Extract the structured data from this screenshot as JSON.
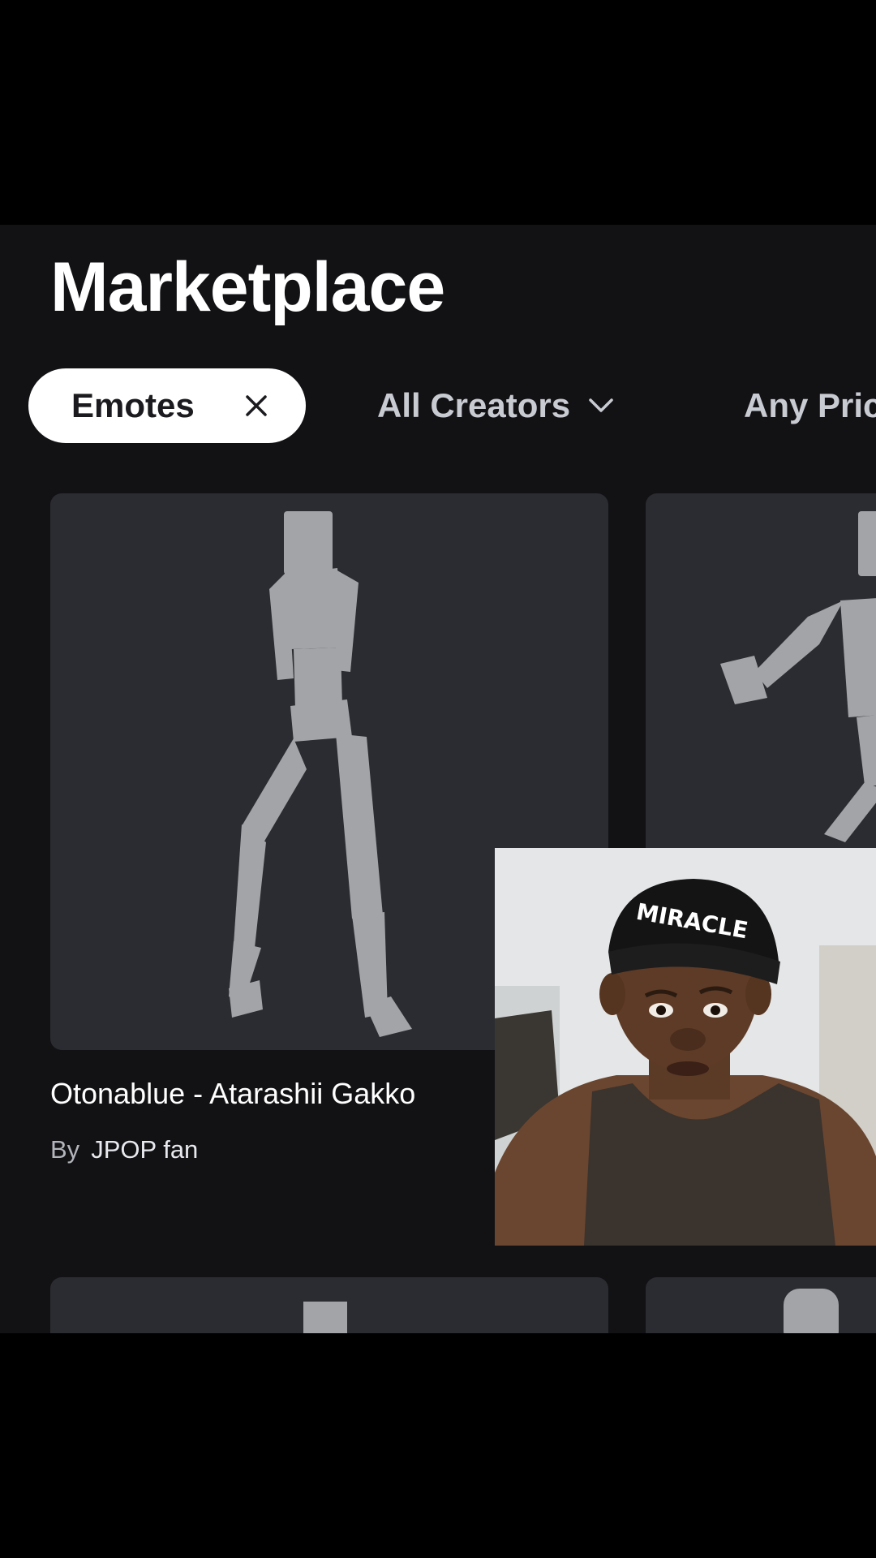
{
  "header": {
    "title": "Marketplace"
  },
  "filters": {
    "active_chip": {
      "label": "Emotes",
      "remove_icon": "close-icon"
    },
    "creators_dropdown": {
      "label": "All Creators",
      "icon": "chevron-down-icon"
    },
    "price_dropdown": {
      "label": "Any Pric"
    }
  },
  "items": [
    {
      "title": "Otonablue - Atarashii Gakko",
      "by_label": "By",
      "creator": "JPOP fan"
    }
  ],
  "overlay": {
    "beanie_text": "MIRACLE"
  },
  "colors": {
    "background": "#121215",
    "card": "#2b2c31",
    "figure": "#a3a4a8",
    "chip": "#ffffff",
    "text_primary": "#ffffff",
    "text_secondary": "#c9cbd3"
  }
}
